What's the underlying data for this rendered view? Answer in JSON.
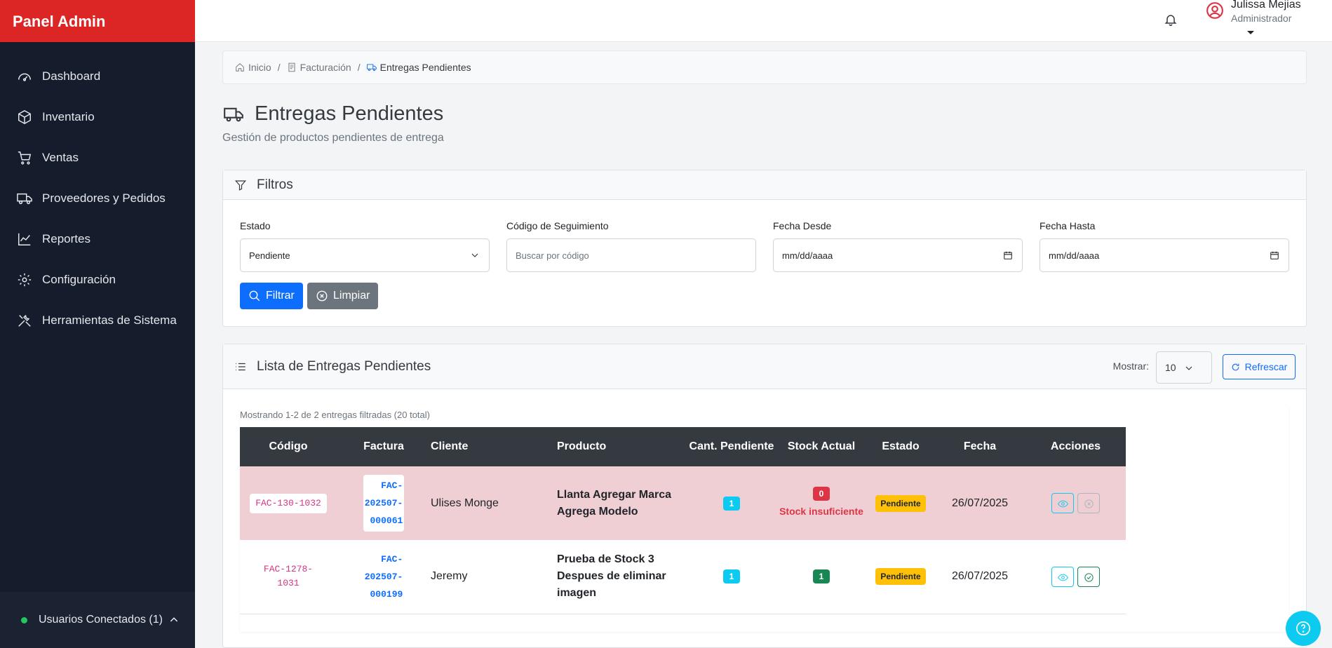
{
  "sidebar": {
    "brand": "Panel Admin",
    "items": [
      {
        "label": "Dashboard",
        "icon": "dashboard-icon"
      },
      {
        "label": "Inventario",
        "icon": "box-icon"
      },
      {
        "label": "Ventas",
        "icon": "cart-icon"
      },
      {
        "label": "Proveedores y Pedidos",
        "icon": "truck-icon"
      },
      {
        "label": "Reportes",
        "icon": "chart-line-icon"
      },
      {
        "label": "Configuración",
        "icon": "gear-icon"
      },
      {
        "label": "Herramientas de Sistema",
        "icon": "tools-icon"
      }
    ],
    "footer": "Usuarios Conectados (1)"
  },
  "topbar": {
    "user_name": "Julissa Mejias",
    "user_role": "Administrador"
  },
  "breadcrumb": {
    "home": "Inicio",
    "section": "Facturación",
    "current": "Entregas Pendientes"
  },
  "page": {
    "title": "Entregas Pendientes",
    "subtitle": "Gestión de productos pendientes de entrega"
  },
  "filters": {
    "title": "Filtros",
    "estado_label": "Estado",
    "estado_value": "Pendiente",
    "codigo_label": "Código de Seguimiento",
    "codigo_placeholder": "Buscar por código",
    "desde_label": "Fecha Desde",
    "desde_value": "mm/dd/aaaa",
    "hasta_label": "Fecha Hasta",
    "hasta_value": "mm/dd/aaaa",
    "filter_button": "Filtrar",
    "clear_button": "Limpiar"
  },
  "list": {
    "title": "Lista de Entregas Pendientes",
    "show_label": "Mostrar:",
    "show_value": "10",
    "refresh_button": "Refrescar",
    "results_text": "Mostrando 1-2 de 2 entregas filtradas (20 total)",
    "columns": [
      "Código",
      "Factura",
      "Cliente",
      "Producto",
      "Cant. Pendiente",
      "Stock Actual",
      "Estado",
      "Fecha",
      "Acciones"
    ],
    "rows": [
      {
        "codigo": "FAC-130-1032",
        "factura": "FAC-\n202507-\n000061",
        "cliente": "Ulises Monge",
        "producto": "Llanta Agregar Marca Agrega Modelo",
        "cantidad": "1",
        "stock": "0",
        "stock_msg": "Stock insuficiente",
        "estado": "Pendiente",
        "fecha": "26/07/2025"
      },
      {
        "codigo": "FAC-1278-\n1031",
        "factura": "FAC-\n202507-\n000199",
        "cliente": "Jeremy",
        "producto": "Prueba de Stock 3 Despues de eliminar imagen",
        "cantidad": "1",
        "stock": "1",
        "stock_msg": "",
        "estado": "Pendiente",
        "fecha": "26/07/2025"
      }
    ]
  },
  "colors": {
    "brand_red": "#dc2626",
    "sidebar_bg": "#151c2c",
    "primary": "#0d6efd",
    "danger_row": "#efcfd3"
  }
}
